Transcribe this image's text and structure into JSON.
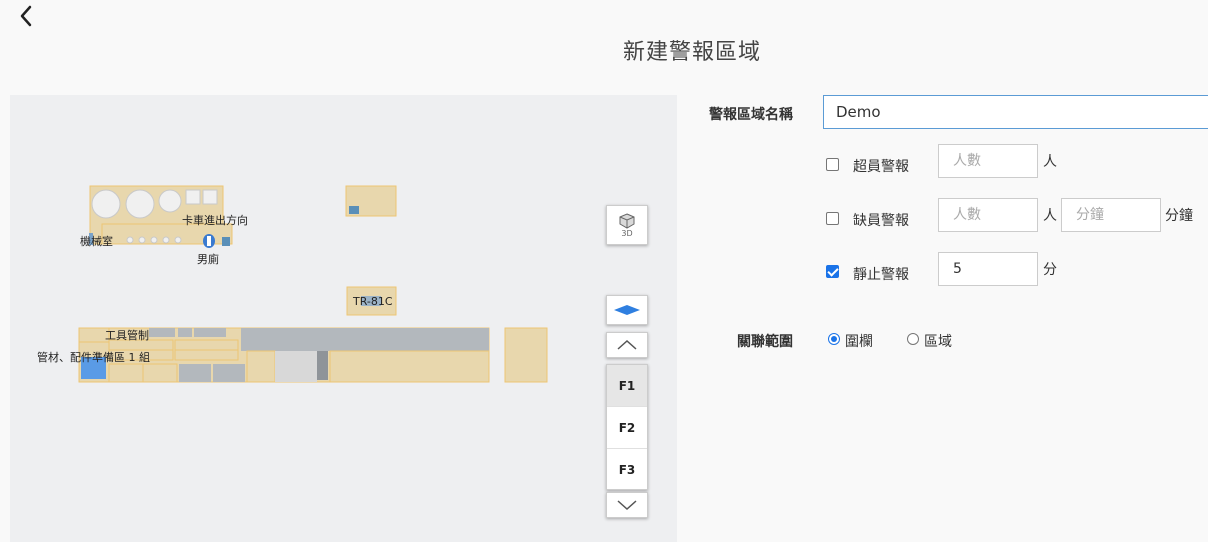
{
  "header": {
    "back_icon": "chevron-left-icon",
    "title": "新建警報區域"
  },
  "map": {
    "labels": {
      "machine_room": "機械室",
      "truck_direction": "卡車進出方向",
      "mens_restroom": "男廁",
      "tr_code": "TR-81C",
      "tool_control": "工具管制",
      "pipe_parts": "管材、配件準備區 1 組"
    },
    "controls": {
      "btn_3d_label": "3D",
      "floors": [
        "F1",
        "F2",
        "F3"
      ],
      "active_floor": "F1"
    },
    "colors": {
      "room_fill": "#e8d7ad",
      "room_stroke": "#edc672",
      "gray_block": "#b3b8bd",
      "blue_accent": "#5a9be6",
      "layer_icon": "#2f7fe0"
    }
  },
  "form": {
    "name": {
      "label": "警報區域名稱",
      "value": "Demo"
    },
    "over_capacity": {
      "checked": false,
      "label": "超員警報",
      "placeholder": "人數",
      "unit": "人"
    },
    "under_capacity": {
      "checked": false,
      "label": "缺員警報",
      "people_placeholder": "人數",
      "people_unit": "人",
      "minutes_placeholder": "分鐘",
      "minutes_unit": "分鐘"
    },
    "stationary": {
      "checked": true,
      "label": "靜止警報",
      "value": "5",
      "unit": "分"
    },
    "association": {
      "label": "關聯範圍",
      "options": [
        "圍欄",
        "區域"
      ],
      "selected": "圍欄"
    }
  }
}
